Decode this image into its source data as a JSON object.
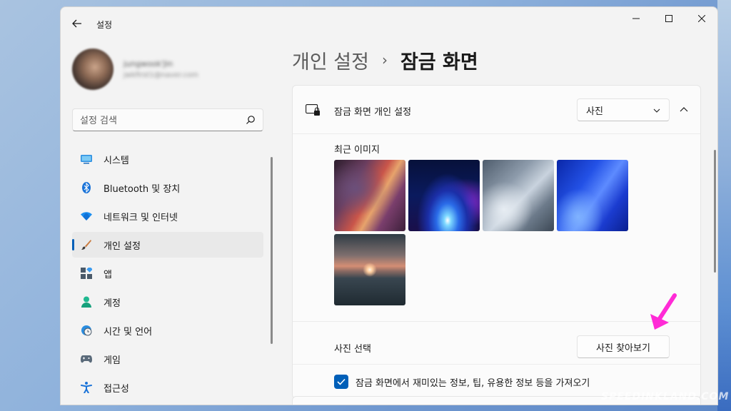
{
  "window": {
    "app_title": "설정"
  },
  "profile": {
    "name": "jungwook'Jin",
    "email": "jwkfirst1@naver.com"
  },
  "search": {
    "placeholder": "설정 검색"
  },
  "sidebar": {
    "items": [
      {
        "label": "시스템",
        "icon": "system-icon"
      },
      {
        "label": "Bluetooth 및 장치",
        "icon": "bluetooth-icon"
      },
      {
        "label": "네트워크 및 인터넷",
        "icon": "wifi-icon"
      },
      {
        "label": "개인 설정",
        "icon": "brush-icon",
        "active": true
      },
      {
        "label": "앱",
        "icon": "apps-icon"
      },
      {
        "label": "계정",
        "icon": "account-icon"
      },
      {
        "label": "시간 및 언어",
        "icon": "globe-clock-icon"
      },
      {
        "label": "게임",
        "icon": "gamepad-icon"
      },
      {
        "label": "접근성",
        "icon": "accessibility-icon"
      }
    ]
  },
  "breadcrumb": {
    "parent": "개인 설정",
    "separator": "›",
    "current": "잠금 화면"
  },
  "lockscreen": {
    "title": "잠금 화면 개인 설정",
    "dropdown_value": "사진",
    "recent_images_label": "최근 이미지",
    "select_photo_label": "사진 선택",
    "browse_button": "사진 찾아보기",
    "fun_facts_label": "잠금 화면에서 재미있는 정보, 팁, 유용한 정보 등을 가져오기",
    "fun_facts_checked": true
  },
  "watermark": "SPEEDINKLAND.COM",
  "colors": {
    "accent": "#005fb8",
    "annotation_arrow": "#ff2bd6"
  }
}
